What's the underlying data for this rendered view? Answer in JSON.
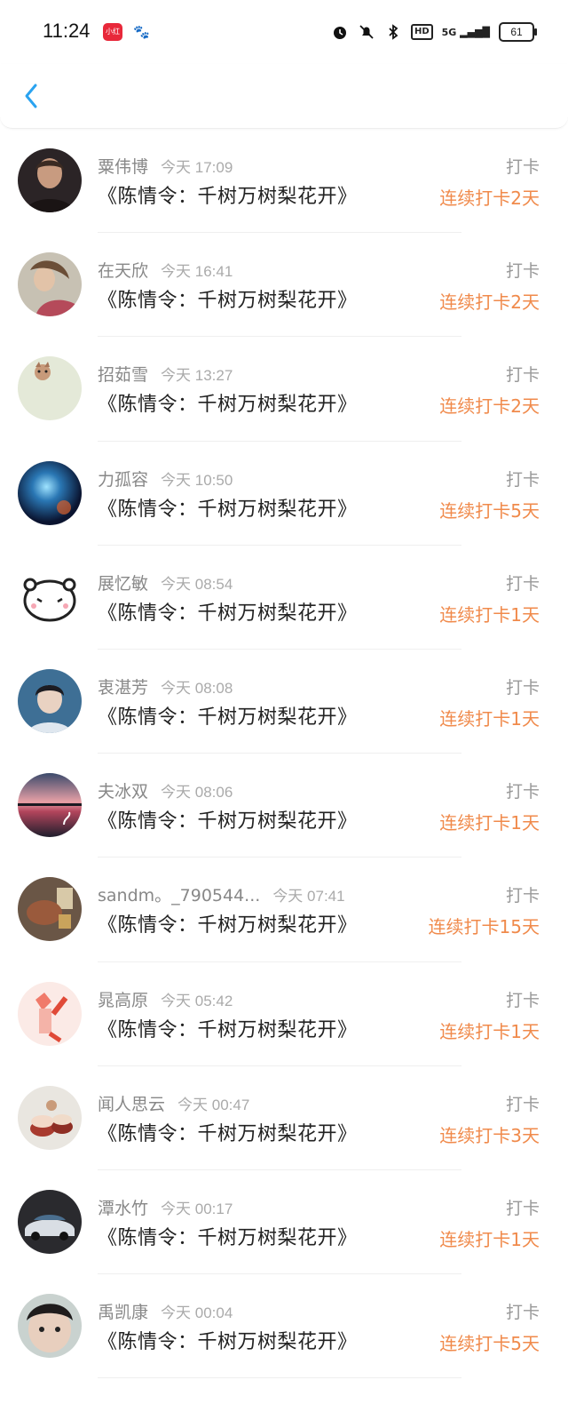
{
  "status": {
    "time": "11:24",
    "red_app_label": "小红书",
    "network": "5G",
    "hd": "HD",
    "battery": "61"
  },
  "items": [
    {
      "name": "粟伟博",
      "time": "今天 17:09",
      "title": "《陈情令：千树万树梨花开》",
      "action": "打卡",
      "streak": "连续打卡2天",
      "avatar": "avatar-man"
    },
    {
      "name": "在天欣",
      "time": "今天 16:41",
      "title": "《陈情令：千树万树梨花开》",
      "action": "打卡",
      "streak": "连续打卡2天",
      "avatar": "avatar-woman"
    },
    {
      "name": "招茹雪",
      "time": "今天 13:27",
      "title": "《陈情令：千树万树梨花开》",
      "action": "打卡",
      "streak": "连续打卡2天",
      "avatar": "avatar-pet"
    },
    {
      "name": "力孤容",
      "time": "今天 10:50",
      "title": "《陈情令：千树万树梨花开》",
      "action": "打卡",
      "streak": "连续打卡5天",
      "avatar": "avatar-nebula"
    },
    {
      "name": "展忆敏",
      "time": "今天 08:54",
      "title": "《陈情令：千树万树梨花开》",
      "action": "打卡",
      "streak": "连续打卡1天",
      "avatar": "avatar-cartoon"
    },
    {
      "name": "衷湛芳",
      "time": "今天 08:08",
      "title": "《陈情令：千树万树梨花开》",
      "action": "打卡",
      "streak": "连续打卡1天",
      "avatar": "avatar-boy"
    },
    {
      "name": "夫冰双",
      "time": "今天 08:06",
      "title": "《陈情令：千树万树梨花开》",
      "action": "打卡",
      "streak": "连续打卡1天",
      "avatar": "avatar-sunset"
    },
    {
      "name": "sandm。_790544...",
      "time": "今天 07:41",
      "title": "《陈情令：千树万树梨花开》",
      "action": "打卡",
      "streak": "连续打卡15天",
      "avatar": "avatar-room"
    },
    {
      "name": "晁高原",
      "time": "今天 05:42",
      "title": "《陈情令：千树万树梨花开》",
      "action": "打卡",
      "streak": "连续打卡1天",
      "avatar": "avatar-illustration"
    },
    {
      "name": "闻人思云",
      "time": "今天 00:47",
      "title": "《陈情令：千树万树梨花开》",
      "action": "打卡",
      "streak": "连续打卡3天",
      "avatar": "avatar-cupcake"
    },
    {
      "name": "潭水竹",
      "time": "今天 00:17",
      "title": "《陈情令：千树万树梨花开》",
      "action": "打卡",
      "streak": "连续打卡1天",
      "avatar": "avatar-car"
    },
    {
      "name": "禹凯康",
      "time": "今天 00:04",
      "title": "《陈情令：千树万树梨花开》",
      "action": "打卡",
      "streak": "连续打卡5天",
      "avatar": "avatar-child"
    }
  ],
  "colors": {
    "accent": "#f08a4b",
    "back": "#2aa3f0"
  }
}
